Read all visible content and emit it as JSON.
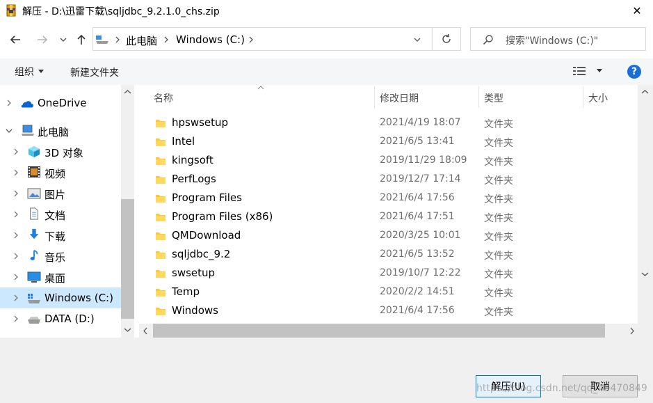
{
  "window": {
    "title": "解压 - D:\\迅雷下载\\sqljdbc_9.2.1.0_chs.zip",
    "close_glyph": "✕"
  },
  "address": {
    "breadcrumb_root": "此电脑",
    "breadcrumb_drive": "Windows (C:)",
    "search_placeholder": "搜索\"Windows (C:)\""
  },
  "toolbar": {
    "organize": "组织",
    "new_folder": "新建文件夹",
    "help": "?"
  },
  "nav": {
    "items": [
      {
        "label": "OneDrive",
        "icon": "onedrive-icon"
      },
      {
        "label": "此电脑",
        "icon": "computer-icon"
      },
      {
        "label": "3D 对象",
        "icon": "3d-objects-icon"
      },
      {
        "label": "视频",
        "icon": "video-icon"
      },
      {
        "label": "图片",
        "icon": "pictures-icon"
      },
      {
        "label": "文档",
        "icon": "documents-icon"
      },
      {
        "label": "下载",
        "icon": "download-icon"
      },
      {
        "label": "音乐",
        "icon": "music-icon"
      },
      {
        "label": "桌面",
        "icon": "desktop-icon"
      },
      {
        "label": "Windows (C:)",
        "icon": "drive-c-icon"
      },
      {
        "label": "DATA (D:)",
        "icon": "drive-d-icon"
      }
    ]
  },
  "columns": {
    "name": "名称",
    "modified": "修改日期",
    "type": "类型",
    "size": "大小"
  },
  "files": [
    {
      "name": "hpswsetup",
      "date": "2021/4/19 18:07",
      "type": "文件夹"
    },
    {
      "name": "Intel",
      "date": "2021/6/5 13:41",
      "type": "文件夹"
    },
    {
      "name": "kingsoft",
      "date": "2019/11/29 18:09",
      "type": "文件夹"
    },
    {
      "name": "PerfLogs",
      "date": "2019/12/7 17:14",
      "type": "文件夹"
    },
    {
      "name": "Program Files",
      "date": "2021/6/4 17:56",
      "type": "文件夹"
    },
    {
      "name": "Program Files (x86)",
      "date": "2021/6/4 17:51",
      "type": "文件夹"
    },
    {
      "name": "QMDownload",
      "date": "2020/3/25 10:01",
      "type": "文件夹"
    },
    {
      "name": "sqljdbc_9.2",
      "date": "2021/6/5 13:52",
      "type": "文件夹"
    },
    {
      "name": "swsetup",
      "date": "2019/10/7 12:22",
      "type": "文件夹"
    },
    {
      "name": "Temp",
      "date": "2020/2/2 14:51",
      "type": "文件夹"
    },
    {
      "name": "Windows",
      "date": "2021/6/4 17:56",
      "type": "文件夹"
    }
  ],
  "footer": {
    "extract_button": "解压(U)",
    "cancel_button": "取消",
    "watermark": "https://blog.csdn.net/qq_40470849"
  },
  "colors": {
    "accent": "#0078d7",
    "folder": "#ffc83d",
    "selected": "#cce8ff",
    "help": "#1a6ed8"
  }
}
